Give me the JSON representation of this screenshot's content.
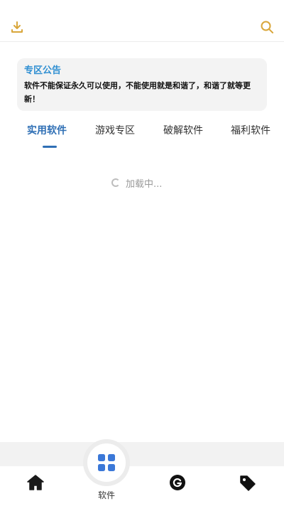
{
  "header": {
    "download_icon": "download-icon",
    "search_icon": "search-icon",
    "accent_color": "#d9a63a"
  },
  "notice": {
    "title": "专区公告",
    "body": "软件不能保证永久可以使用，不能使用就是和谐了，和谐了就等更新！",
    "title_color": "#2f8fd2"
  },
  "tabs": [
    {
      "label": "实用软件",
      "active": true
    },
    {
      "label": "游戏专区",
      "active": false
    },
    {
      "label": "破解软件",
      "active": false
    },
    {
      "label": "福利软件",
      "active": false
    }
  ],
  "loading": {
    "text": "加载中..."
  },
  "bottom_nav": {
    "center_label": "软件",
    "items": [
      {
        "icon": "home-icon"
      },
      {
        "icon": "grid-icon"
      },
      {
        "icon": "g-icon"
      },
      {
        "icon": "tag-icon"
      }
    ]
  }
}
